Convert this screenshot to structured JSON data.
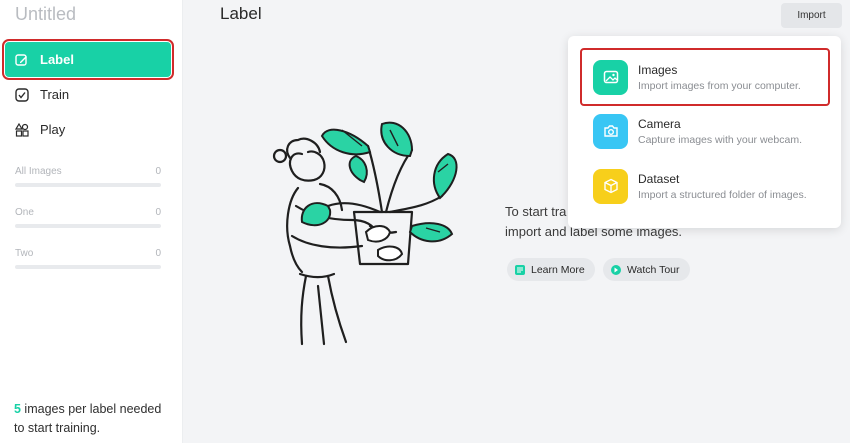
{
  "app": {
    "title": "Untitled"
  },
  "nav": {
    "items": [
      {
        "label": "Label",
        "icon": "edit-icon"
      },
      {
        "label": "Train",
        "icon": "check-square-icon"
      },
      {
        "label": "Play",
        "icon": "shapes-icon"
      }
    ]
  },
  "classes": [
    {
      "name": "All Images",
      "count": "0"
    },
    {
      "name": "One",
      "count": "0"
    },
    {
      "name": "Two",
      "count": "0"
    }
  ],
  "footnote": {
    "count": "5",
    "text": " images per label needed to start training."
  },
  "header": {
    "title": "Label",
    "import_label": "Import"
  },
  "intro": {
    "line1": "To start tra",
    "line2": "import and label some images."
  },
  "actions": {
    "learn_more": "Learn More",
    "watch_tour": "Watch Tour"
  },
  "import_menu": {
    "options": [
      {
        "title": "Images",
        "desc": "Import images from your computer.",
        "icon": "image-icon",
        "color": "#18d1a6"
      },
      {
        "title": "Camera",
        "desc": "Capture images with your webcam.",
        "icon": "camera-icon",
        "color": "#38c6f4"
      },
      {
        "title": "Dataset",
        "desc": "Import a structured folder of images.",
        "icon": "box-icon",
        "color": "#f7cf1b"
      }
    ]
  },
  "colors": {
    "accent": "#18d1a6",
    "highlight": "#d02b2b"
  }
}
